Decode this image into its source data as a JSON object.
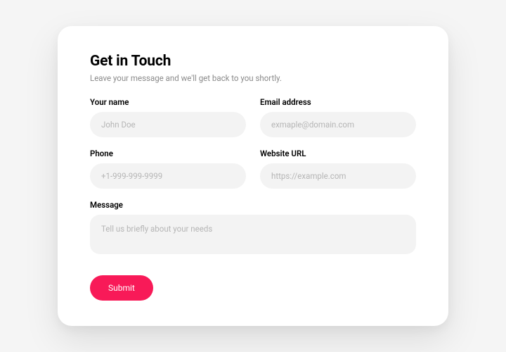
{
  "header": {
    "title": "Get in Touch",
    "subtitle": "Leave your message and we'll get back to you shortly."
  },
  "fields": {
    "name": {
      "label": "Your name",
      "placeholder": "John Doe",
      "value": ""
    },
    "email": {
      "label": "Email address",
      "placeholder": "exmaple@domain.com",
      "value": ""
    },
    "phone": {
      "label": "Phone",
      "placeholder": "+1-999-999-9999",
      "value": ""
    },
    "website": {
      "label": "Website URL",
      "placeholder": "https://example.com",
      "value": ""
    },
    "message": {
      "label": "Message",
      "placeholder": "Tell us briefly about your needs",
      "value": ""
    }
  },
  "actions": {
    "submit_label": "Submit"
  },
  "colors": {
    "accent": "#f81a58"
  }
}
